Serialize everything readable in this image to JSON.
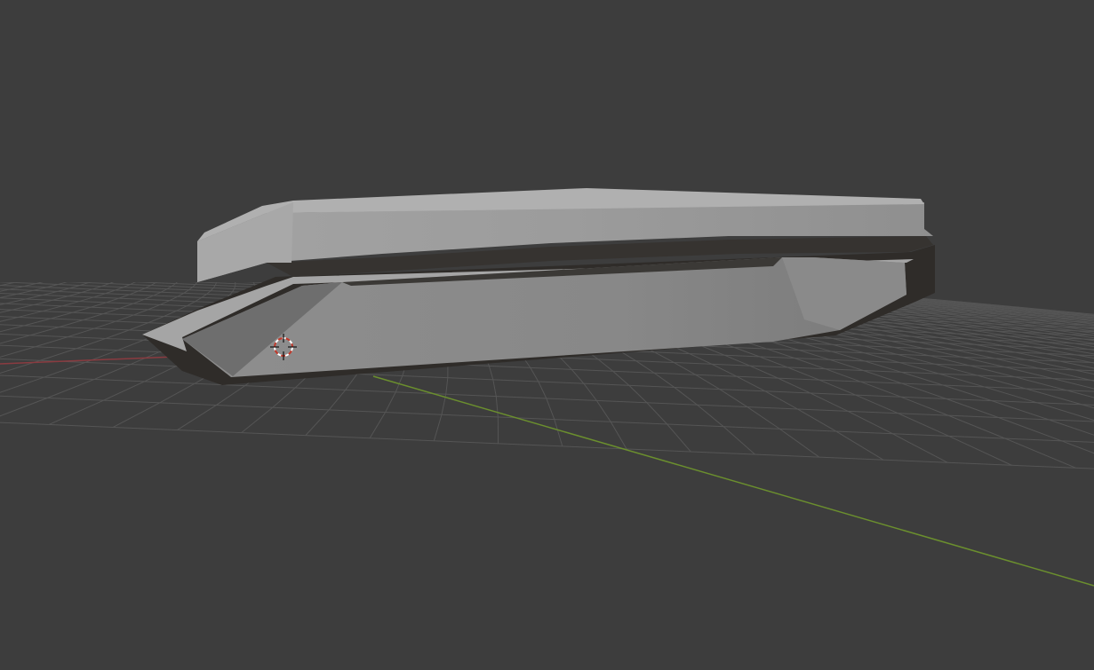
{
  "viewport": {
    "background_color": "#3d3d3d",
    "grid_line_color": "#555555",
    "x_axis_color": "#8a3b40",
    "y_axis_color": "#6b8f2e",
    "object_light_color": "#9a9a9a",
    "object_mid_color": "#848484",
    "object_dark_color": "#2f2c29",
    "cursor_color": "#c0392b"
  },
  "scene": {
    "object_name": "mesh-object",
    "cursor_icon": "3d-cursor-icon"
  }
}
